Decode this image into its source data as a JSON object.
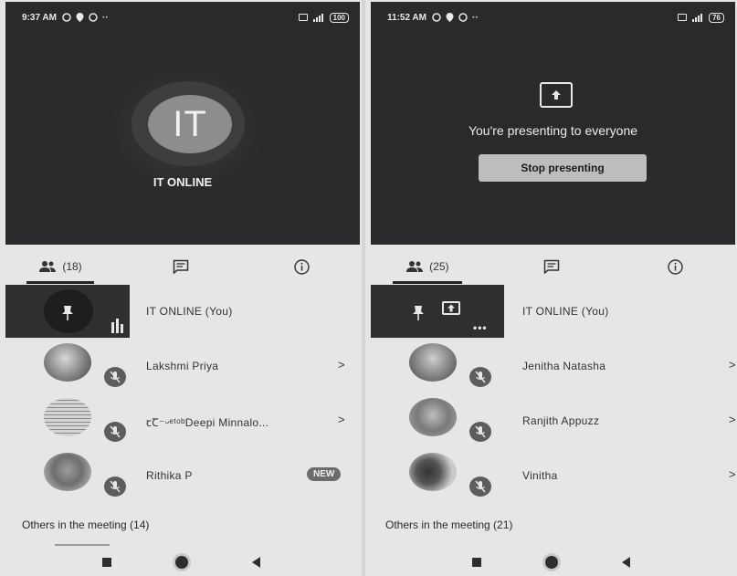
{
  "left": {
    "status": {
      "time": "9:37 AM",
      "battery": "100"
    },
    "call": {
      "initials": "IT",
      "name": "IT ONLINE"
    },
    "tabs": {
      "people_count": "(18)"
    },
    "self": {
      "name": "IT ONLINE (You)"
    },
    "participants": [
      {
        "name": "Lakshmi Priya",
        "trailing": ">"
      },
      {
        "name": "ꞇꞆ⁻ᵕᵉᵗᵒᵇDeepi Minnalo...",
        "trailing": ">"
      },
      {
        "name": "Rithika P",
        "badge": "NEW"
      }
    ],
    "others": "Others in the meeting (14)"
  },
  "right": {
    "status": {
      "time": "11:52 AM",
      "battery": "76"
    },
    "presenting": {
      "message": "You're presenting to everyone",
      "stop_label": "Stop presenting"
    },
    "tabs": {
      "people_count": "(25)"
    },
    "self": {
      "name": "IT ONLINE (You)"
    },
    "participants": [
      {
        "name": "Jenitha Natasha",
        "trailing": ">"
      },
      {
        "name": "Ranjith Appuzz",
        "trailing": ">"
      },
      {
        "name": "Vinitha",
        "trailing": ">"
      }
    ],
    "others": "Others in the meeting (21)"
  },
  "icons": [
    "people-icon",
    "chat-icon",
    "info-icon",
    "pin-icon",
    "mic-off-icon",
    "present-screen-icon",
    "more-dots-icon",
    "chevron-right-icon"
  ],
  "colors": {
    "call_bg": "#2a2a2c",
    "panel_bg": "#e6e6e4",
    "tile_bg": "#2f2f31"
  }
}
